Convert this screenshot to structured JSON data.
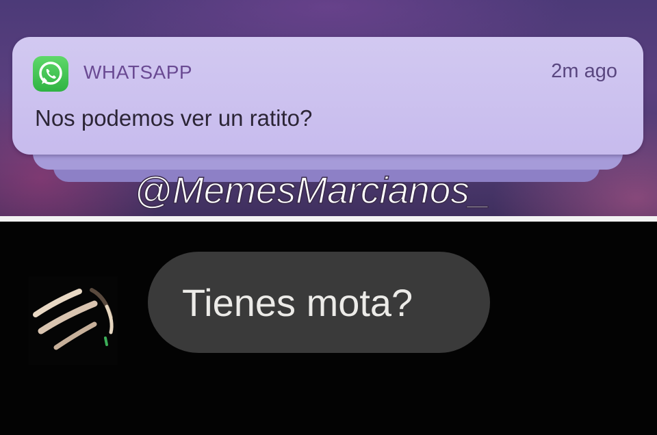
{
  "notification": {
    "app_name": "WHATSAPP",
    "timestamp": "2m ago",
    "message": "Nos podemos ver un ratito?",
    "icon": "whatsapp-icon",
    "icon_color": "#3dbd4f"
  },
  "watermark": {
    "text": "@MemesMarcianos_"
  },
  "chat": {
    "message": "Tienes mota?",
    "bubble_color": "#3a3a3a",
    "avatar": "avatar-image"
  }
}
